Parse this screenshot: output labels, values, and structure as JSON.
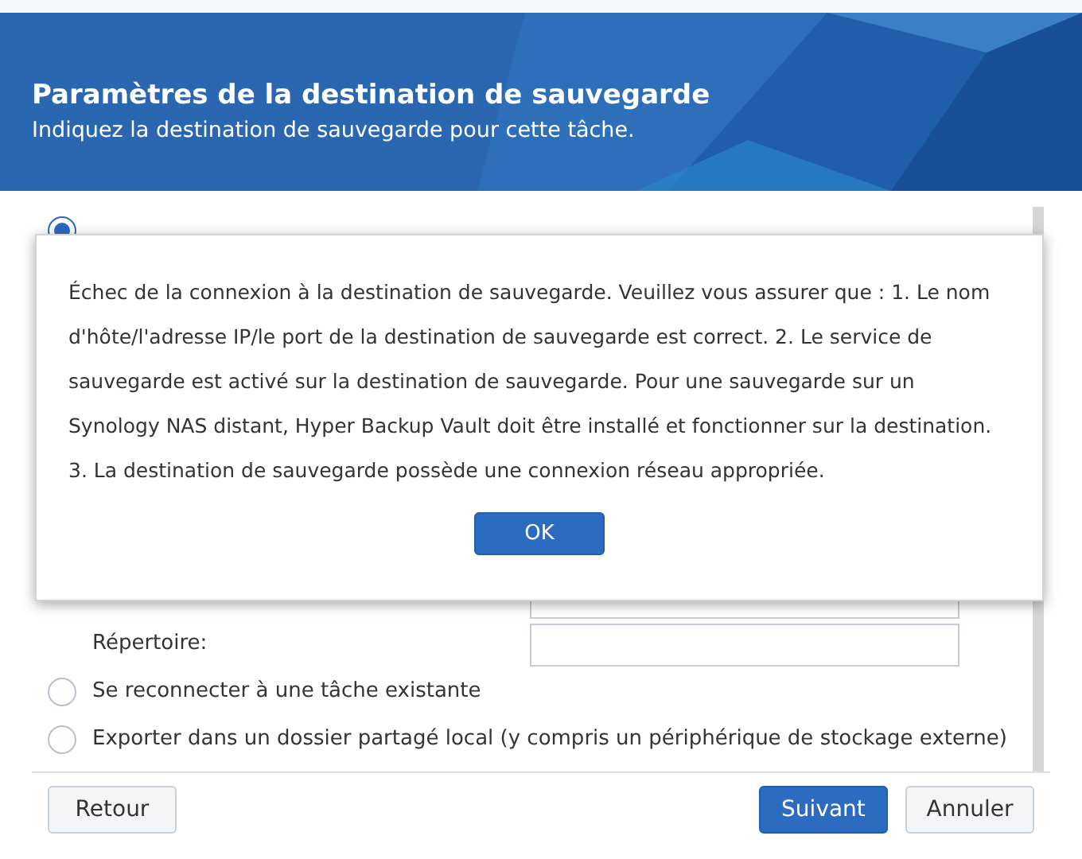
{
  "header": {
    "title": "Paramètres de la destination de sauvegarde",
    "subtitle": "Indiquez la destination de sauvegarde pour cette tâche."
  },
  "options": [
    {
      "kind": "radio",
      "selected": true
    },
    {
      "kind": "field"
    },
    {
      "kind": "field",
      "label": "Répertoire:"
    },
    {
      "kind": "radio",
      "label": "Se reconnecter à une tâche existante",
      "selected": false
    },
    {
      "kind": "radio",
      "label": "Exporter dans un dossier partagé local (y compris un périphérique de stockage externe)",
      "selected": false
    }
  ],
  "footer": {
    "back": "Retour",
    "next": "Suivant",
    "cancel": "Annuler"
  },
  "dialog": {
    "message": "Échec de la connexion à la destination de sauvegarde. Veuillez vous assurer que : 1. Le nom d'hôte/l'adresse IP/le port de la destination de sauvegarde est correct. 2. Le service de sauvegarde est activé sur la destination de sauvegarde. Pour une sauvegarde sur un Synology NAS distant, Hyper Backup Vault doit être installé et fonctionner sur la destination. 3. La destination de sauvegarde possède une connexion réseau appropriée.",
    "button": "OK"
  }
}
